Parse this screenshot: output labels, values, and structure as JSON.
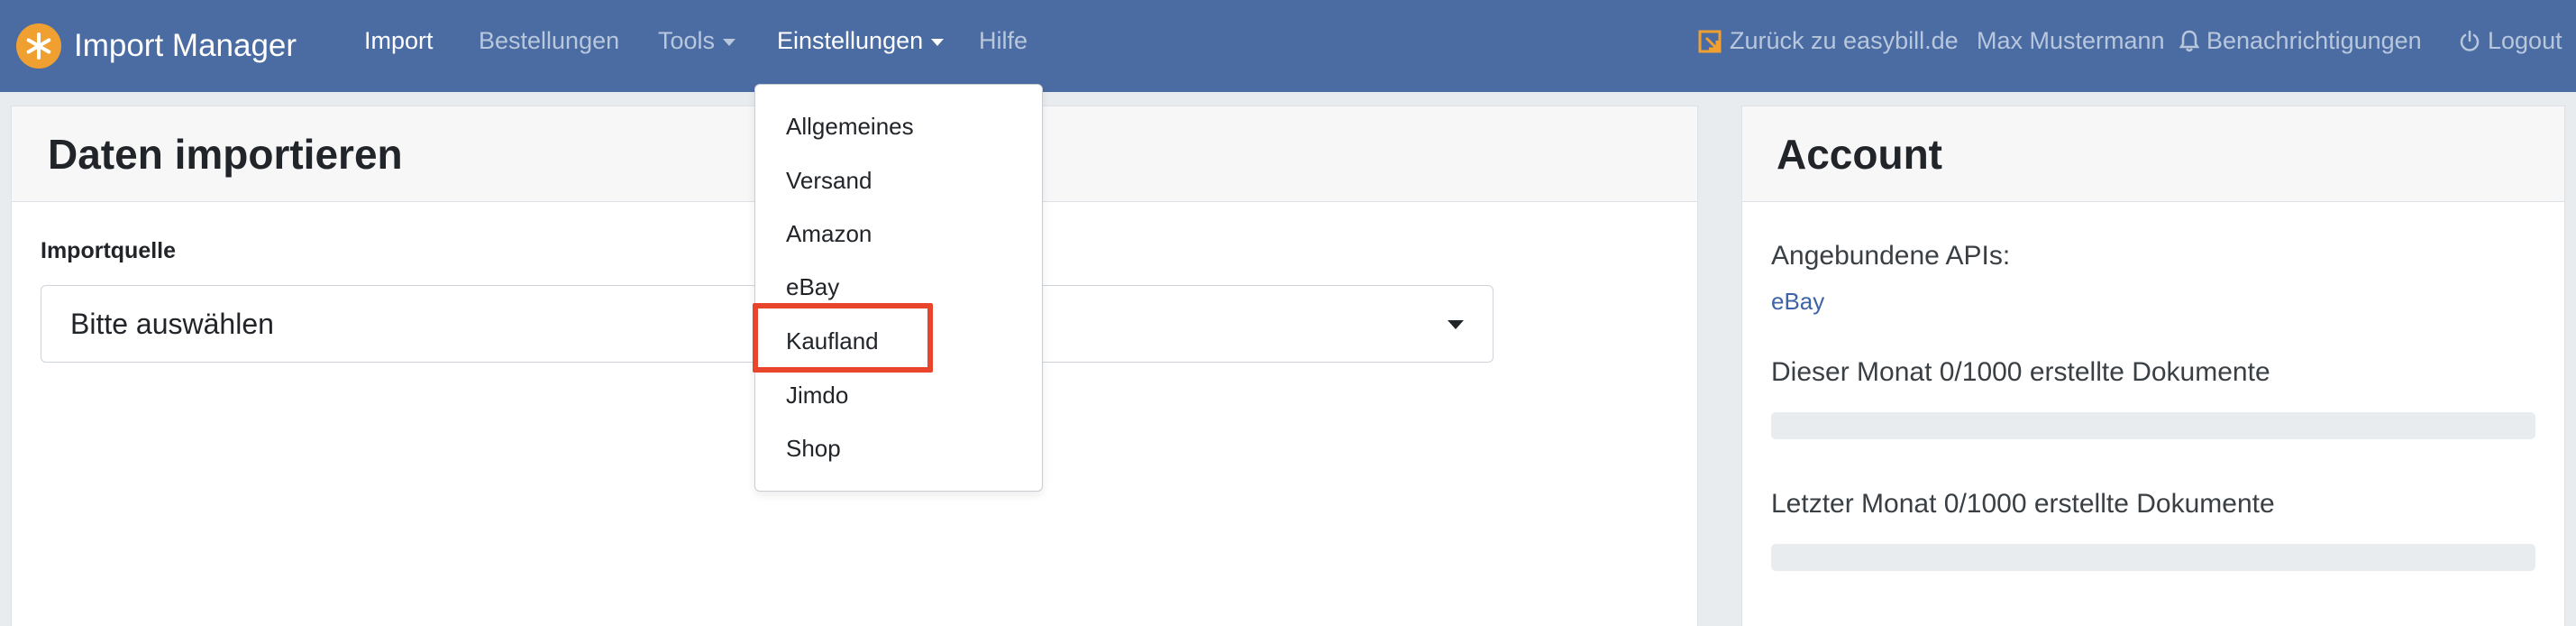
{
  "navbar": {
    "brand": "Import Manager",
    "items": [
      {
        "label": "Import",
        "active": true
      },
      {
        "label": "Bestellungen"
      },
      {
        "label": "Tools",
        "has_caret": true
      },
      {
        "label": "Einstellungen",
        "has_caret": true,
        "active": true
      },
      {
        "label": "Hilfe"
      }
    ],
    "right": {
      "back_label": "Zurück zu easybill.de",
      "user_name": "Max Mustermann",
      "notifications_label": "Benachrichtigungen",
      "logout_label": "Logout"
    },
    "colors": {
      "background": "#4a6ca3",
      "brand_icon": "#f0a030"
    }
  },
  "dropdown": {
    "items": [
      "Allgemeines",
      "Versand",
      "Amazon",
      "eBay",
      "Kaufland",
      "Jimdo",
      "Shop"
    ],
    "highlighted": "Kaufland",
    "highlight_color": "#e8452c"
  },
  "main": {
    "title": "Daten importieren",
    "import_source_label": "Importquelle",
    "select_value": "Bitte auswählen"
  },
  "account": {
    "title": "Account",
    "apis_label": "Angebundene APIs:",
    "apis_value": "eBay",
    "this_month_label": "Dieser Monat 0/1000 erstellte Dokumente",
    "this_month_progress": 0,
    "last_month_label": "Letzter Monat 0/1000 erstellte Dokumente",
    "last_month_progress": 0
  }
}
